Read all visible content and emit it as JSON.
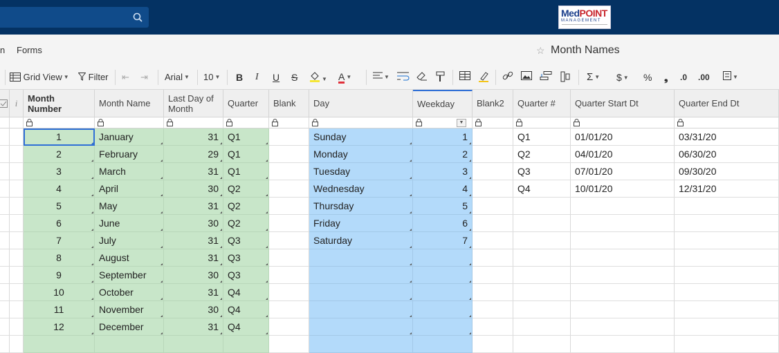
{
  "header": {
    "search_placeholder": "",
    "logo": {
      "med": "Med",
      "point": "POINT",
      "sub": "MANAGEMENT"
    }
  },
  "menubar": {
    "partial_item": "n",
    "forms_label": "Forms",
    "sheet_title": "Month Names"
  },
  "toolbar": {
    "grid_view": "Grid View",
    "filter": "Filter",
    "font": "Arial",
    "size": "10",
    "bold": "B",
    "italic": "I",
    "underline": "U",
    "strike": "S",
    "font_color": "A",
    "sum": "Σ",
    "currency": "$",
    "percent": "%",
    "comma": "❟",
    "dec_less": ".0",
    "dec_more": ".00"
  },
  "columns": [
    {
      "key": "month_number",
      "label": "Month Number"
    },
    {
      "key": "month_name",
      "label": "Month Name"
    },
    {
      "key": "last_day",
      "label": "Last Day of Month"
    },
    {
      "key": "quarter",
      "label": "Quarter"
    },
    {
      "key": "blank",
      "label": "Blank"
    },
    {
      "key": "day",
      "label": "Day"
    },
    {
      "key": "weekday",
      "label": "Weekday"
    },
    {
      "key": "blank2",
      "label": "Blank2"
    },
    {
      "key": "quarter_num",
      "label": "Quarter #"
    },
    {
      "key": "quarter_start",
      "label": "Quarter Start Dt"
    },
    {
      "key": "quarter_end",
      "label": "Quarter End Dt"
    }
  ],
  "rows": [
    {
      "month_number": "1",
      "month_name": "January",
      "last_day": "31",
      "quarter": "Q1",
      "day": "Sunday",
      "weekday": "1",
      "quarter_num": "Q1",
      "quarter_start": "01/01/20",
      "quarter_end": "03/31/20"
    },
    {
      "month_number": "2",
      "month_name": "February",
      "last_day": "29",
      "quarter": "Q1",
      "day": "Monday",
      "weekday": "2",
      "quarter_num": "Q2",
      "quarter_start": "04/01/20",
      "quarter_end": "06/30/20"
    },
    {
      "month_number": "3",
      "month_name": "March",
      "last_day": "31",
      "quarter": "Q1",
      "day": "Tuesday",
      "weekday": "3",
      "quarter_num": "Q3",
      "quarter_start": "07/01/20",
      "quarter_end": "09/30/20"
    },
    {
      "month_number": "4",
      "month_name": "April",
      "last_day": "30",
      "quarter": "Q2",
      "day": "Wednesday",
      "weekday": "4",
      "quarter_num": "Q4",
      "quarter_start": "10/01/20",
      "quarter_end": "12/31/20"
    },
    {
      "month_number": "5",
      "month_name": "May",
      "last_day": "31",
      "quarter": "Q2",
      "day": "Thursday",
      "weekday": "5"
    },
    {
      "month_number": "6",
      "month_name": "June",
      "last_day": "30",
      "quarter": "Q2",
      "day": "Friday",
      "weekday": "6"
    },
    {
      "month_number": "7",
      "month_name": "July",
      "last_day": "31",
      "quarter": "Q3",
      "day": "Saturday",
      "weekday": "7"
    },
    {
      "month_number": "8",
      "month_name": "August",
      "last_day": "31",
      "quarter": "Q3"
    },
    {
      "month_number": "9",
      "month_name": "September",
      "last_day": "30",
      "quarter": "Q3"
    },
    {
      "month_number": "10",
      "month_name": "October",
      "last_day": "31",
      "quarter": "Q4"
    },
    {
      "month_number": "11",
      "month_name": "November",
      "last_day": "30",
      "quarter": "Q4"
    },
    {
      "month_number": "12",
      "month_name": "December",
      "last_day": "31",
      "quarter": "Q4"
    },
    {}
  ],
  "colors": {
    "topbar": "#043263",
    "search": "#104b8a",
    "green": "#c8e6c9",
    "blue": "#b3dafa",
    "selection": "#2f6fd6"
  }
}
